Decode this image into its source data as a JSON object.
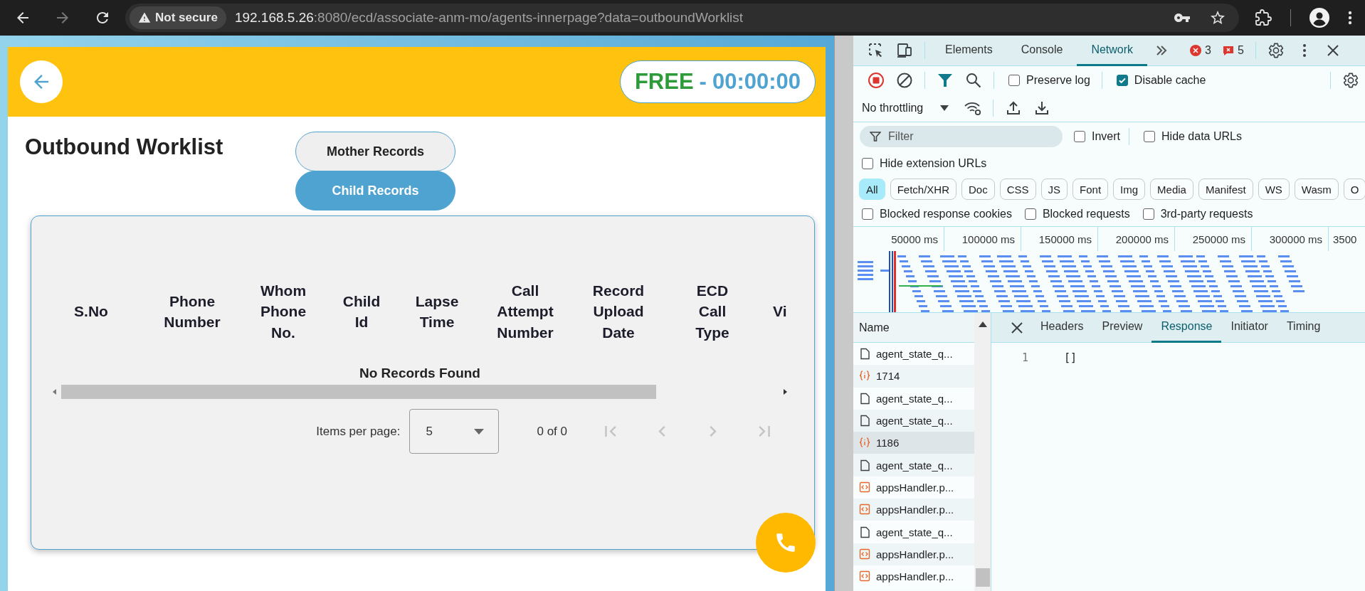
{
  "browser": {
    "nav": [
      {
        "kind": "back",
        "disabled": false
      },
      {
        "kind": "forward",
        "disabled": true
      },
      {
        "kind": "reload",
        "disabled": false
      }
    ],
    "security": "Not secure",
    "url_host": "192.168.5.26",
    "url_rest": ":8080/ecd/associate-anm-mo/agents-innerpage?data=outboundWorklist"
  },
  "app": {
    "status": {
      "state": "FREE",
      "separator": "-",
      "timer": "00:00:00"
    },
    "title": "Outbound Worklist",
    "record_tabs": [
      {
        "label": "Mother Records",
        "selected": false
      },
      {
        "label": "Child Records",
        "selected": true
      }
    ],
    "table": {
      "columns": [
        "S.No",
        "Phone Number",
        "Whom Phone No.",
        "Child Id",
        "Lapse Time",
        "Call Attempt Number",
        "Record Upload Date",
        "ECD Call Type",
        "Vi"
      ],
      "empty_message": "No Records Found"
    },
    "paginator": {
      "label": "Items per page:",
      "page_size": "5",
      "range": "0 of 0",
      "nav": [
        {
          "kind": "first",
          "disabled": true
        },
        {
          "kind": "prev",
          "disabled": true
        },
        {
          "kind": "next",
          "disabled": true
        },
        {
          "kind": "last",
          "disabled": true
        }
      ]
    }
  },
  "devtools": {
    "tabs": [
      {
        "label": "Elements",
        "selected": false
      },
      {
        "label": "Console",
        "selected": false
      },
      {
        "label": "Network",
        "selected": true
      }
    ],
    "errors": "3",
    "issues": "5",
    "recording": true,
    "preserve_log": {
      "label": "Preserve log",
      "checked": false
    },
    "disable_cache": {
      "label": "Disable cache",
      "checked": true
    },
    "throttling": "No throttling",
    "filter": {
      "placeholder": "Filter"
    },
    "invert": {
      "label": "Invert",
      "checked": false
    },
    "hide_data_urls": {
      "label": "Hide data URLs",
      "checked": false
    },
    "hide_extension_urls": {
      "label": "Hide extension URLs",
      "checked": false
    },
    "types": [
      {
        "label": "All",
        "selected": true
      },
      {
        "label": "Fetch/XHR",
        "selected": false
      },
      {
        "label": "Doc",
        "selected": false
      },
      {
        "label": "CSS",
        "selected": false
      },
      {
        "label": "JS",
        "selected": false
      },
      {
        "label": "Font",
        "selected": false
      },
      {
        "label": "Img",
        "selected": false
      },
      {
        "label": "Media",
        "selected": false
      },
      {
        "label": "Manifest",
        "selected": false
      },
      {
        "label": "WS",
        "selected": false
      },
      {
        "label": "Wasm",
        "selected": false
      },
      {
        "label": "O",
        "selected": false
      }
    ],
    "blocked": [
      {
        "label": "Blocked response cookies",
        "checked": false
      },
      {
        "label": "Blocked requests",
        "checked": false
      },
      {
        "label": "3rd-party requests",
        "checked": false
      }
    ],
    "overview_ticks": [
      "50000 ms",
      "100000 ms",
      "150000 ms",
      "200000 ms",
      "250000 ms",
      "300000 ms",
      "3500"
    ],
    "requests_header": "Name",
    "requests": [
      {
        "name": "agent_state_q...",
        "kind": "doc",
        "selected": false
      },
      {
        "name": "1714",
        "kind": "json",
        "selected": false
      },
      {
        "name": "agent_state_q...",
        "kind": "doc",
        "selected": false
      },
      {
        "name": "agent_state_q...",
        "kind": "doc",
        "selected": false
      },
      {
        "name": "1186",
        "kind": "json",
        "selected": true
      },
      {
        "name": "agent_state_q...",
        "kind": "doc",
        "selected": false
      },
      {
        "name": "appsHandler.p...",
        "kind": "script",
        "selected": false
      },
      {
        "name": "appsHandler.p...",
        "kind": "script",
        "selected": false
      },
      {
        "name": "agent_state_q...",
        "kind": "doc",
        "selected": false
      },
      {
        "name": "appsHandler.p...",
        "kind": "script",
        "selected": false
      },
      {
        "name": "appsHandler.p...",
        "kind": "script",
        "selected": false
      }
    ],
    "detail_tabs": [
      {
        "label": "Headers",
        "selected": false
      },
      {
        "label": "Preview",
        "selected": false
      },
      {
        "label": "Response",
        "selected": true
      },
      {
        "label": "Initiator",
        "selected": false
      },
      {
        "label": "Timing",
        "selected": false
      }
    ],
    "response": {
      "line_number": "1",
      "content": "[]"
    }
  }
}
